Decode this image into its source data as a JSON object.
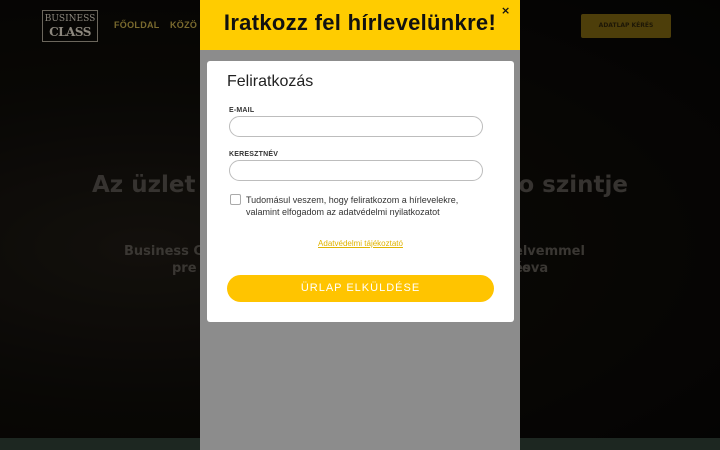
{
  "background": {
    "logo": {
      "line1": "BUSINESS",
      "line2": "CLASS"
    },
    "nav": [
      "FŐOLDAL",
      "KÖZÖ"
    ],
    "header_button": "ADATLAP KÉRÉS",
    "hero_title_left": "Az üzlet",
    "hero_title_right": "o szintje",
    "hero_sub_left": "Business C",
    "hero_sub_right": "elvemmel és",
    "hero_sub_left2": "pre",
    "hero_sub_right2": "ova"
  },
  "popup": {
    "heading": "Iratkozz fel hírlevelünkre!",
    "close": "×",
    "form": {
      "title": "Feliratkozás",
      "email_label": "E-MAIL",
      "email_value": "",
      "name_label": "KERESZTNÉV",
      "name_value": "",
      "consent_checked": false,
      "consent_text": "Tudomásul veszem, hogy feliratkozom a hírlevelekre, valamint elfogadom az adatvédelmi nyilatkozatot",
      "privacy_link": "Adatvédelmi tájékoztató",
      "submit": "ÜRLAP ELKÜLDÉSE"
    }
  },
  "colors": {
    "accent": "#ffcc00",
    "button": "#ffc400",
    "link": "#e0b300"
  }
}
